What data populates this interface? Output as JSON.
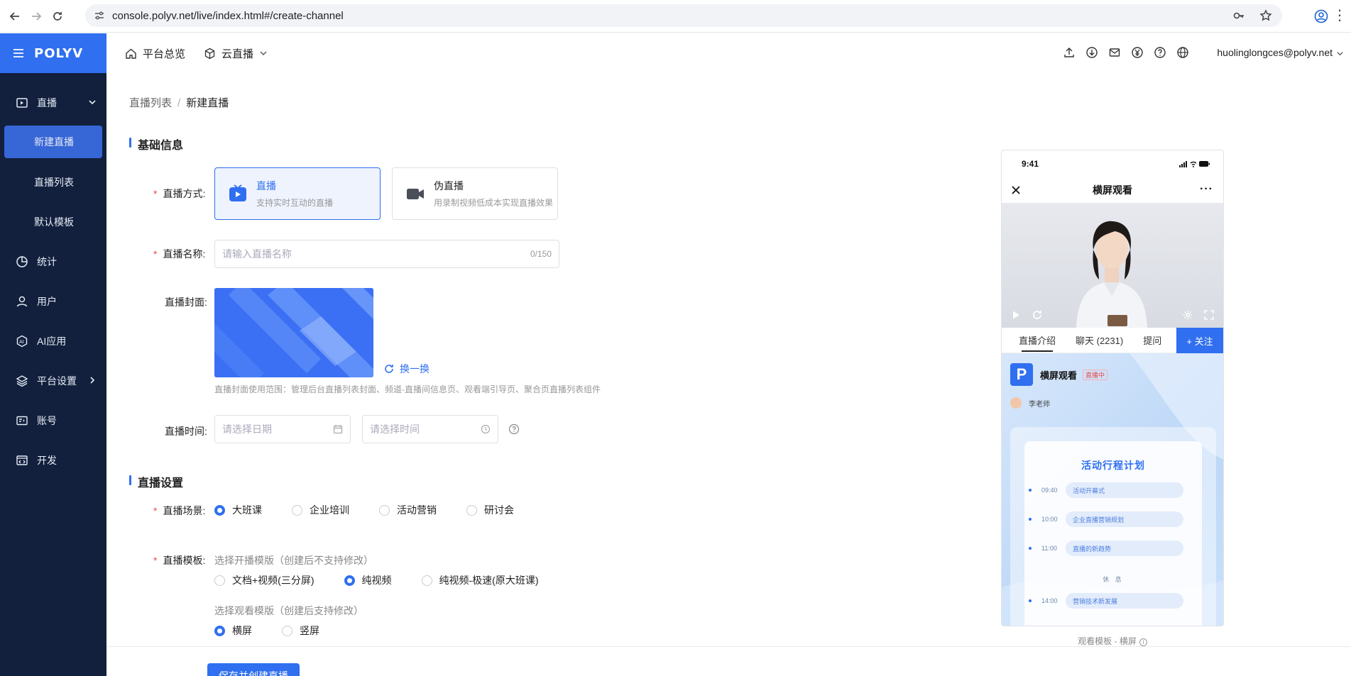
{
  "browser": {
    "url": "console.polyv.net/live/index.html#/create-channel"
  },
  "sidebar": {
    "brand": "POLYV",
    "items": [
      {
        "label": "直播",
        "icon": "live-icon"
      },
      {
        "label": "新建直播",
        "sub": true,
        "active": true
      },
      {
        "label": "直播列表",
        "sub": true
      },
      {
        "label": "默认模板",
        "sub": true
      },
      {
        "label": "统计",
        "icon": "chart-pie-icon"
      },
      {
        "label": "用户",
        "icon": "user-icon"
      },
      {
        "label": "AI应用",
        "icon": "ai-icon"
      },
      {
        "label": "平台设置",
        "icon": "layers-icon"
      },
      {
        "label": "账号",
        "icon": "id-card-icon"
      },
      {
        "label": "开发",
        "icon": "code-icon"
      }
    ]
  },
  "topbar": {
    "overview": "平台总览",
    "cloud_live": "云直播",
    "account": "huolinglongces@polyv.net"
  },
  "breadcrumb": {
    "parent": "直播列表",
    "separator": "/",
    "current": "新建直播"
  },
  "basic": {
    "section_title": "基础信息",
    "mode_label": "直播方式:",
    "modes": [
      {
        "title": "直播",
        "desc": "支持实时互动的直播",
        "selected": true
      },
      {
        "title": "伪直播",
        "desc": "用录制视频低成本实现直播效果",
        "selected": false
      }
    ],
    "name_label": "直播名称:",
    "name_placeholder": "请输入直播名称",
    "name_count": "0/150",
    "cover_label": "直播封面:",
    "cover_swap": "换一换",
    "cover_hint": "直播封面使用范围：管理后台直播列表封面、频道-直播间信息页、观看端引导页、聚合页直播列表组件",
    "time_label": "直播时间:",
    "date_placeholder": "请选择日期",
    "time_placeholder": "请选择时间"
  },
  "settings": {
    "section_title": "直播设置",
    "scene_label": "直播场景:",
    "scenes": [
      {
        "label": "大班课",
        "checked": true
      },
      {
        "label": "企业培训",
        "checked": false
      },
      {
        "label": "活动营销",
        "checked": false
      },
      {
        "label": "研讨会",
        "checked": false
      }
    ],
    "template_label": "直播模板:",
    "start_template_hint": "选择开播模版（创建后不支持修改）",
    "start_templates": [
      {
        "label": "文档+视频(三分屏)",
        "checked": false
      },
      {
        "label": "纯视频",
        "checked": true
      },
      {
        "label": "纯视频-极速(原大班课)",
        "checked": false
      }
    ],
    "watch_template_hint": "选择观看模版（创建后支持修改）",
    "watch_templates": [
      {
        "label": "横屏",
        "checked": true
      },
      {
        "label": "竖屏",
        "checked": false
      }
    ]
  },
  "footer": {
    "save": "保存并创建直播"
  },
  "preview": {
    "time": "9:41",
    "title": "横屏观看",
    "more": "···",
    "tabs": [
      "直播介绍",
      "聊天 (2231)",
      "提问"
    ],
    "follow": "+ 关注",
    "channel_name": "横屏观看",
    "live_badge": "直播中",
    "teacher": "李老师",
    "plan_title": "活动行程计划",
    "plan": [
      {
        "time": "09:40",
        "item": "活动开幕式"
      },
      {
        "time": "10:00",
        "item": "企业直播营销规划"
      },
      {
        "time": "11:00",
        "item": "直播的新趋势"
      }
    ],
    "rest": "休 息",
    "plan_after": [
      {
        "time": "14:00",
        "item": "营销技术新发展"
      }
    ],
    "caption": "观看模板 - 横屏",
    "info_glyph": "i"
  }
}
